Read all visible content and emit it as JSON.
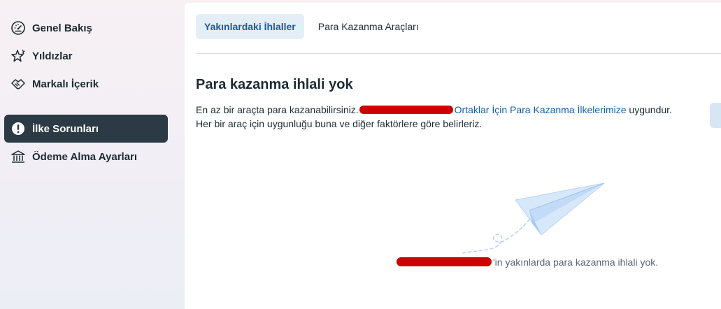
{
  "sidebar": {
    "items": [
      {
        "label": "Genel Bakış",
        "icon": "gauge-icon"
      },
      {
        "label": "Yıldızlar",
        "icon": "stars-icon"
      },
      {
        "label": "Markalı İçerik",
        "icon": "handshake-icon"
      },
      {
        "label": "İlke Sorunları",
        "icon": "alert-circle-icon",
        "active": true
      },
      {
        "label": "Ödeme Alma Ayarları",
        "icon": "bank-icon"
      }
    ]
  },
  "main": {
    "tabs": [
      {
        "label": "Yakınlardaki İhlaller",
        "active": true
      },
      {
        "label": "Para Kazanma Araçları",
        "active": false
      }
    ],
    "title": "Para kazanma ihlali yok",
    "description": {
      "line1_before": "En az bir araçta para kazanabilirsiniz.",
      "line1_link": "Ortaklar İçin Para Kazanma İlkelerimize",
      "line1_after": " uygundur.",
      "line2": "Her bir araç için uygunluğu buna ve diğer faktörlere göre belirleriz."
    },
    "empty_state": {
      "illustration": "paper-plane-icon",
      "message_suffix": "'in yakınlarda para kazanma ihlali yok."
    }
  },
  "colors": {
    "active_nav_bg": "#2b3a44",
    "active_tab_bg": "#e4eef7",
    "link": "#155ea6",
    "redaction": "#cc0000"
  }
}
